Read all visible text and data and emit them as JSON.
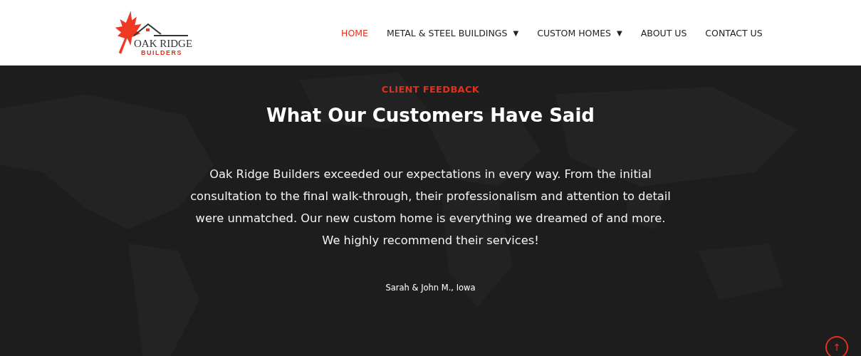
{
  "logo": {
    "line_1": "OAK RIDGE",
    "line_2": "BUILDERS"
  },
  "nav": [
    {
      "label": "HOME",
      "selected": true
    },
    {
      "label": "METAL & STEEL BUILDINGS",
      "caret": "▼",
      "selected": false
    },
    {
      "label": "CUSTOM HOMES",
      "caret": "▼",
      "selected": false
    },
    {
      "label": "ABOUT US",
      "selected": false
    },
    {
      "label": "CONTACT US",
      "selected": false
    }
  ],
  "testimonial": {
    "eyebrow": "CLIENT FEEDBACK",
    "title": "What Our Customers Have Said",
    "quote": "Oak Ridge Builders exceeded our expectations in every way. From the initial consultation to the final walk-through, their professionalism and attention to detail were unmatched. Our new custom home is everything we dreamed of and more. We highly recommend their services!",
    "author": "Sarah & John M., Iowa"
  }
}
